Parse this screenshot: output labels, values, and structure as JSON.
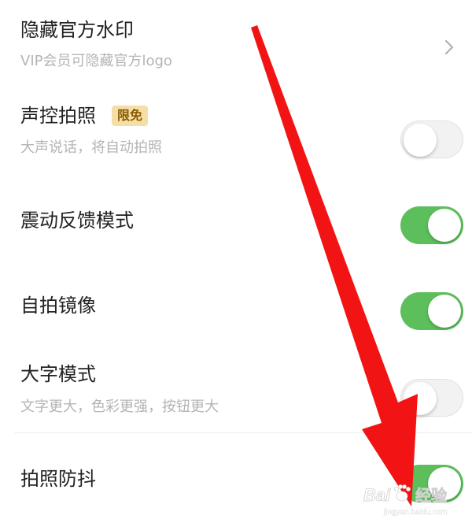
{
  "colors": {
    "toggle_on": "#5cbf5c",
    "toggle_off": "#f2f2f2",
    "badge_bg": "#f4dfa6",
    "badge_text": "#8a5a00",
    "arrow": "#f21414"
  },
  "settings": {
    "hide_watermark": {
      "title": "隐藏官方水印",
      "subtitle": "VIP会员可隐藏官方logo",
      "control": "chevron-right-icon"
    },
    "voice_photo": {
      "title": "声控拍照",
      "badge": "限免",
      "subtitle": "大声说话，将自动拍照",
      "enabled": false
    },
    "haptic_feedback": {
      "title": "震动反馈模式",
      "enabled": true
    },
    "selfie_mirror": {
      "title": "自拍镜像",
      "enabled": true
    },
    "large_text": {
      "title": "大字模式",
      "subtitle": "文字更大，色彩更强，按钮更大",
      "enabled": false
    },
    "stabilization": {
      "title": "拍照防抖",
      "enabled": true
    }
  },
  "watermark": {
    "brand_text": "Bai",
    "paw_icon": "baidu-paw-icon",
    "suffix_text": "经验",
    "domain_text": "jingyan.baidu.com"
  }
}
